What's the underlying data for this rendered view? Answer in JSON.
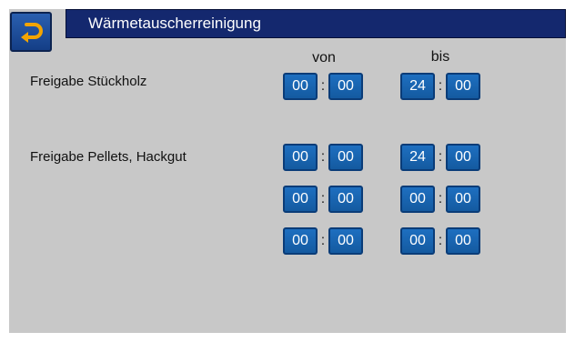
{
  "header": {
    "title": "Wärmetauscherreinigung"
  },
  "columns": {
    "from": "von",
    "to": "bis"
  },
  "time_separator": ":",
  "rows": [
    {
      "label": "Freigabe Stückholz",
      "von": [
        "00",
        "00"
      ],
      "bis": [
        "24",
        "00"
      ]
    },
    {
      "label": "Freigabe Pellets, Hackgut",
      "von": [
        "00",
        "00"
      ],
      "bis": [
        "24",
        "00"
      ]
    },
    {
      "label": "",
      "von": [
        "00",
        "00"
      ],
      "bis": [
        "00",
        "00"
      ]
    },
    {
      "label": "",
      "von": [
        "00",
        "00"
      ],
      "bis": [
        "00",
        "00"
      ]
    }
  ],
  "colors": {
    "title_bar": "#14286e",
    "time_box": "#1e6fc0",
    "screen_background": "#c8c8c8",
    "back_arrow": "#f2a400"
  },
  "icons": {
    "back": "back-arrow-icon"
  }
}
